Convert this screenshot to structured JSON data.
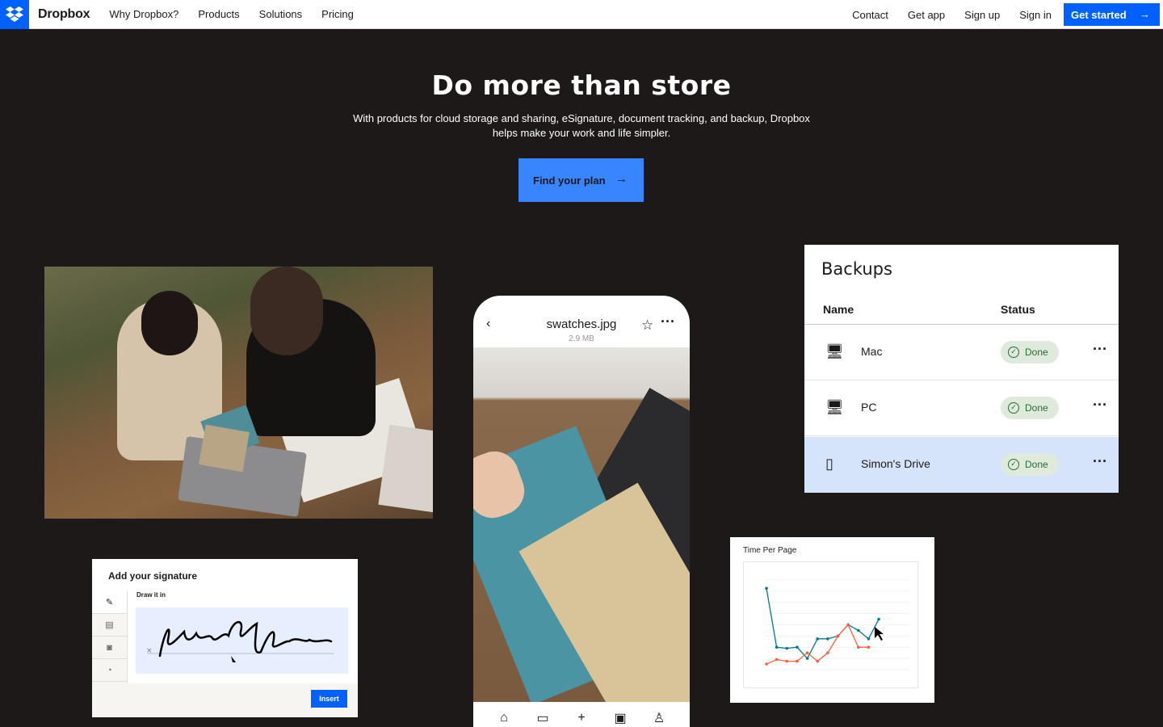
{
  "nav": {
    "brand": "Dropbox",
    "links": [
      "Why Dropbox?",
      "Products",
      "Solutions",
      "Pricing"
    ],
    "right_links": [
      "Contact",
      "Get app",
      "Sign up",
      "Sign in"
    ],
    "cta": "Get started",
    "cta_icon": "arrow-right-icon"
  },
  "hero": {
    "title": "Do more than store",
    "subtitle": "With products for cloud storage and sharing, eSignature, document tracking, and backup, Dropbox helps make your work and life simpler.",
    "button": "Find your plan",
    "button_icon": "arrow-right-icon"
  },
  "phone": {
    "file_name": "swatches.jpg",
    "file_size": "2.9 MB",
    "tabs": [
      "home-icon",
      "folder-icon",
      "plus-icon",
      "image-icon",
      "person-icon"
    ]
  },
  "backups": {
    "title": "Backups",
    "col_name": "Name",
    "col_status": "Status",
    "rows": [
      {
        "name": "Mac",
        "status": "Done",
        "icon": "monitor-icon"
      },
      {
        "name": "PC",
        "status": "Done",
        "icon": "monitor-icon"
      },
      {
        "name": "Simon's Drive",
        "status": "Done",
        "icon": "drive-icon"
      }
    ]
  },
  "signature": {
    "title": "Add your signature",
    "draw_label": "Draw it in",
    "insert": "Insert",
    "tools": [
      "pen-icon",
      "keyboard-icon",
      "camera-icon",
      "clock-icon"
    ]
  },
  "chart_card": {
    "title": "Time Per Page"
  },
  "chart_data": {
    "type": "line",
    "title": "Time Per Page",
    "x": [
      1,
      2,
      3,
      4,
      5,
      6,
      7,
      8,
      9,
      10,
      11,
      12,
      13,
      14,
      15
    ],
    "series": [
      {
        "color": "#007c89",
        "values": [
          145,
          40,
          38,
          40,
          20,
          55,
          55,
          60,
          80,
          70,
          55,
          90
        ]
      },
      {
        "color": "#ff5e3a",
        "values": [
          10,
          18,
          15,
          15,
          30,
          15,
          30,
          60,
          80,
          40,
          40
        ]
      }
    ],
    "ylim": [
      0,
      170
    ],
    "grid": true
  },
  "colors": {
    "accent": "#0061fe",
    "background": "#1e1919",
    "done": "#2b6b34"
  }
}
